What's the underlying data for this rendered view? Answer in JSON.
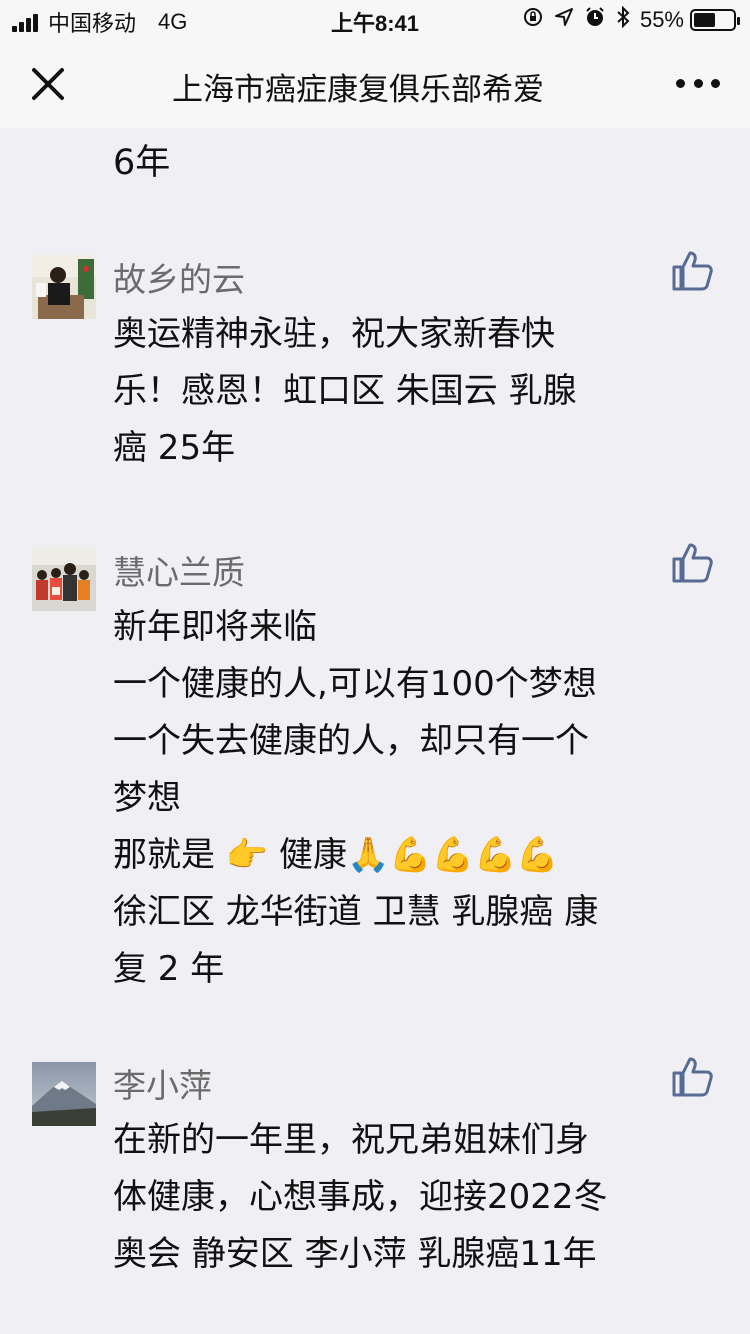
{
  "status_bar": {
    "carrier": "中国移动",
    "network": "4G",
    "time": "上午8:41",
    "battery_percent": "55%",
    "battery_level": 0.55
  },
  "nav": {
    "title": "上海市癌症康复俱乐部希爱"
  },
  "top_partial_text": "6年",
  "comments": [
    {
      "name": "故乡的云",
      "lines": [
        "奥运精神永驻，祝大家新春快",
        "乐！感恩！虹口区 朱国云 乳腺",
        "癌 25年"
      ]
    },
    {
      "name": "慧心兰质",
      "lines": [
        "新年即将来临",
        "一个健康的人,可以有100个梦想",
        "一个失去健康的人，却只有一个",
        "梦想",
        "那就是  👉 健康🙏💪💪💪💪",
        "徐汇区 龙华街道 卫慧 乳腺癌 康",
        "复 2 年"
      ]
    },
    {
      "name": "李小萍",
      "lines": [
        "在新的一年里，祝兄弟姐妹们身",
        "体健康，心想事成，迎接2022冬",
        "奥会  静安区 李小萍 乳腺癌11年"
      ]
    }
  ],
  "colors": {
    "background": "#efeff4",
    "name_gray": "#6b6b6b",
    "like_blue": "#576b95"
  }
}
